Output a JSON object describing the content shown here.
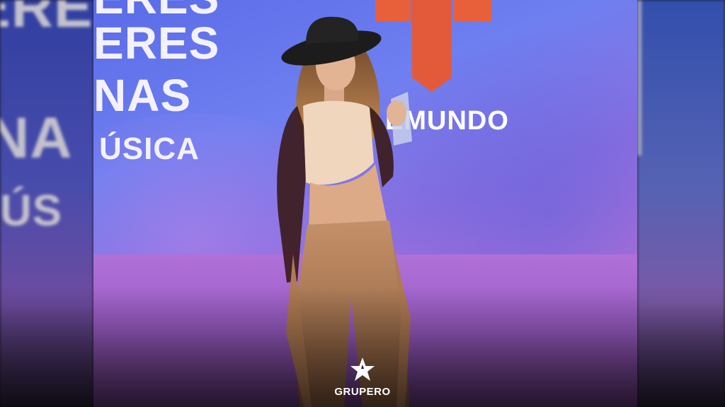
{
  "backdrop": {
    "left_lines": [
      "ERE",
      "NA",
      "ÚS"
    ],
    "center_lines": [
      "ERES",
      "NAS",
      "ÚSICA"
    ],
    "network_word": "EMUNDO",
    "colors": {
      "blue": "#5a6be8",
      "purple": "#b070d8",
      "logo_orange": "#e8603a"
    }
  },
  "brand": {
    "name": "GRUPERO",
    "icon": "star-icon"
  }
}
